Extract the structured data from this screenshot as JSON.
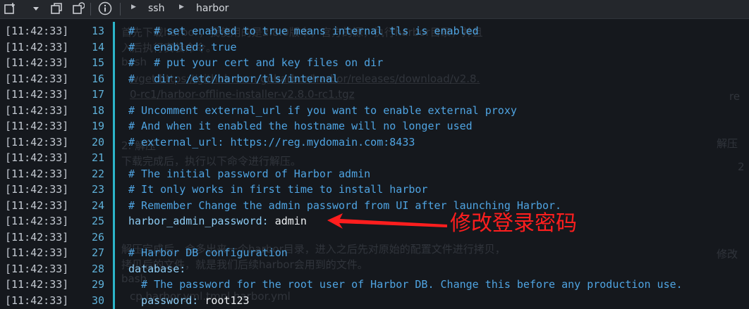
{
  "toolbar": {
    "icons": [
      "new-tab-icon",
      "dropdown-icon",
      "restore-icon",
      "refresh-icon",
      "info-icon"
    ],
    "breadcrumb": [
      "ssh",
      "harbor"
    ]
  },
  "terminal": {
    "lines": [
      {
        "time": "[11:42:33]",
        "num": "13",
        "parts": [
          {
            "t": "#   # set enabled to true means internal tls is enabled",
            "c": "cmt"
          }
        ]
      },
      {
        "time": "[11:42:33]",
        "num": "14",
        "parts": [
          {
            "t": "#   enabled: true",
            "c": "cmt"
          }
        ]
      },
      {
        "time": "[11:42:33]",
        "num": "15",
        "parts": [
          {
            "t": "#   # put your cert and key files on dir",
            "c": "cmt"
          }
        ]
      },
      {
        "time": "[11:42:33]",
        "num": "16",
        "parts": [
          {
            "t": "#   dir: /etc/harbor/tls/internal",
            "c": "cmt"
          }
        ]
      },
      {
        "time": "[11:42:33]",
        "num": "17",
        "parts": []
      },
      {
        "time": "[11:42:33]",
        "num": "18",
        "parts": [
          {
            "t": "# Uncomment external_url if you want to enable external proxy",
            "c": "cmt"
          }
        ]
      },
      {
        "time": "[11:42:33]",
        "num": "19",
        "parts": [
          {
            "t": "# And when it enabled the hostname will no longer used",
            "c": "cmt"
          }
        ]
      },
      {
        "time": "[11:42:33]",
        "num": "20",
        "parts": [
          {
            "t": "# external_url: https://reg.mydomain.com:8433",
            "c": "cmt"
          }
        ]
      },
      {
        "time": "[11:42:33]",
        "num": "21",
        "parts": []
      },
      {
        "time": "[11:42:33]",
        "num": "22",
        "parts": [
          {
            "t": "# The initial password of Harbor admin",
            "c": "cmt"
          }
        ]
      },
      {
        "time": "[11:42:33]",
        "num": "23",
        "parts": [
          {
            "t": "# It only works in first time to install harbor",
            "c": "cmt"
          }
        ]
      },
      {
        "time": "[11:42:33]",
        "num": "24",
        "parts": [
          {
            "t": "# Remember Change the admin password from UI after launching Harbor.",
            "c": "cmt"
          }
        ]
      },
      {
        "time": "[11:42:33]",
        "num": "25",
        "parts": [
          {
            "t": "harbor_admin_password: ",
            "c": "key"
          },
          {
            "t": "admin",
            "c": "val"
          }
        ]
      },
      {
        "time": "[11:42:33]",
        "num": "26",
        "parts": []
      },
      {
        "time": "[11:42:33]",
        "num": "27",
        "parts": [
          {
            "t": "# Harbor DB configuration",
            "c": "cmt"
          }
        ]
      },
      {
        "time": "[11:42:33]",
        "num": "28",
        "parts": [
          {
            "t": "database:",
            "c": "key"
          }
        ]
      },
      {
        "time": "[11:42:33]",
        "num": "29",
        "parts": [
          {
            "t": "  # The password for the root user of Harbor DB. Change this before any production use.",
            "c": "cmt"
          }
        ]
      },
      {
        "time": "[11:42:33]",
        "num": "30",
        "parts": [
          {
            "t": "  password: ",
            "c": "key"
          },
          {
            "t": "root123",
            "c": "val"
          }
        ]
      }
    ]
  },
  "annotation": {
    "text": "修改登录密码",
    "color": "#ff1e1e"
  },
  "background_text": [
    "首先下载harbor，我使用的是2.8.0版本，官方的源，执行harbor目录，并且",
    "入后执行安装命令。",
    "bash",
    "wget https://github.com/goharbor/harbor/releases/download/v2.8.",
    "0-rc1/harbor-offline-installer-v2.8.0-rc1.tgz",
    "2. 解压",
    "下载完成后，执行以下命令进行解压。",
    "解压完成后，会多出来一个harbor目录，进入之后先对原始的配置文件进行拷贝，",
    "拷贝后的文件，就是我们后续harbor会用到的文件。",
    "bash",
    "cp harbor.yml.tmpl harbor.yml",
    "re",
    "解压",
    "2",
    "修改"
  ],
  "colors": {
    "comment": "#4fa4e2",
    "key": "#8ecdf5",
    "value": "#eef1f4",
    "timestamp": "#c2c8d0",
    "line_number": "#5fb0d8",
    "gutter": "#2cb5c9"
  }
}
